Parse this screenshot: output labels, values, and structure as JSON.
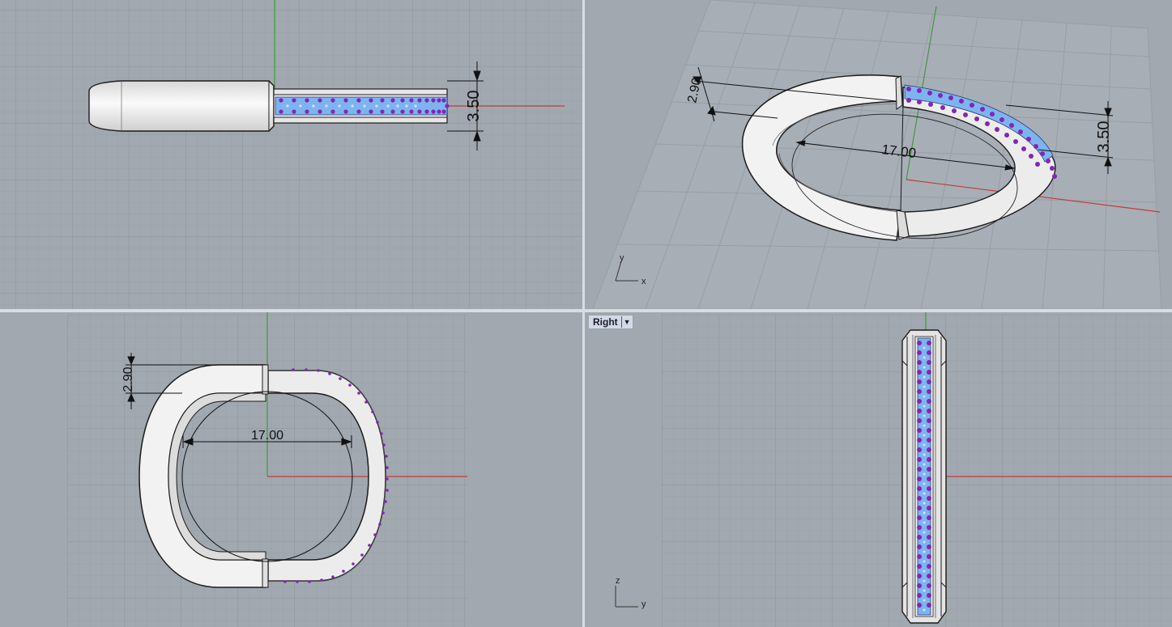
{
  "app": "Rhinoceros",
  "colors": {
    "viewport_bg": "#a1a8b0",
    "grid_minor": "#98a0a8",
    "grid_major": "#8a929b",
    "x_axis": "#c23a3a",
    "y_axis": "#3e9b3e",
    "metal": "#f0f0f0",
    "channel": "#7db4f0",
    "gems": "#8226b5"
  },
  "viewports": {
    "top": {
      "dimensions": {
        "height": "3.50"
      }
    },
    "perspective": {
      "dimensions": {
        "width": "2.90",
        "diameter": "17.00",
        "height": "3.50"
      },
      "axis_labels": {
        "x": "x",
        "y": "y"
      }
    },
    "front": {
      "dimensions": {
        "width": "2.90",
        "diameter": "17.00"
      }
    },
    "right": {
      "title": "Right",
      "menu_icon": "chevron-down-icon",
      "axis_labels": {
        "z": "z",
        "y": "y"
      }
    }
  }
}
